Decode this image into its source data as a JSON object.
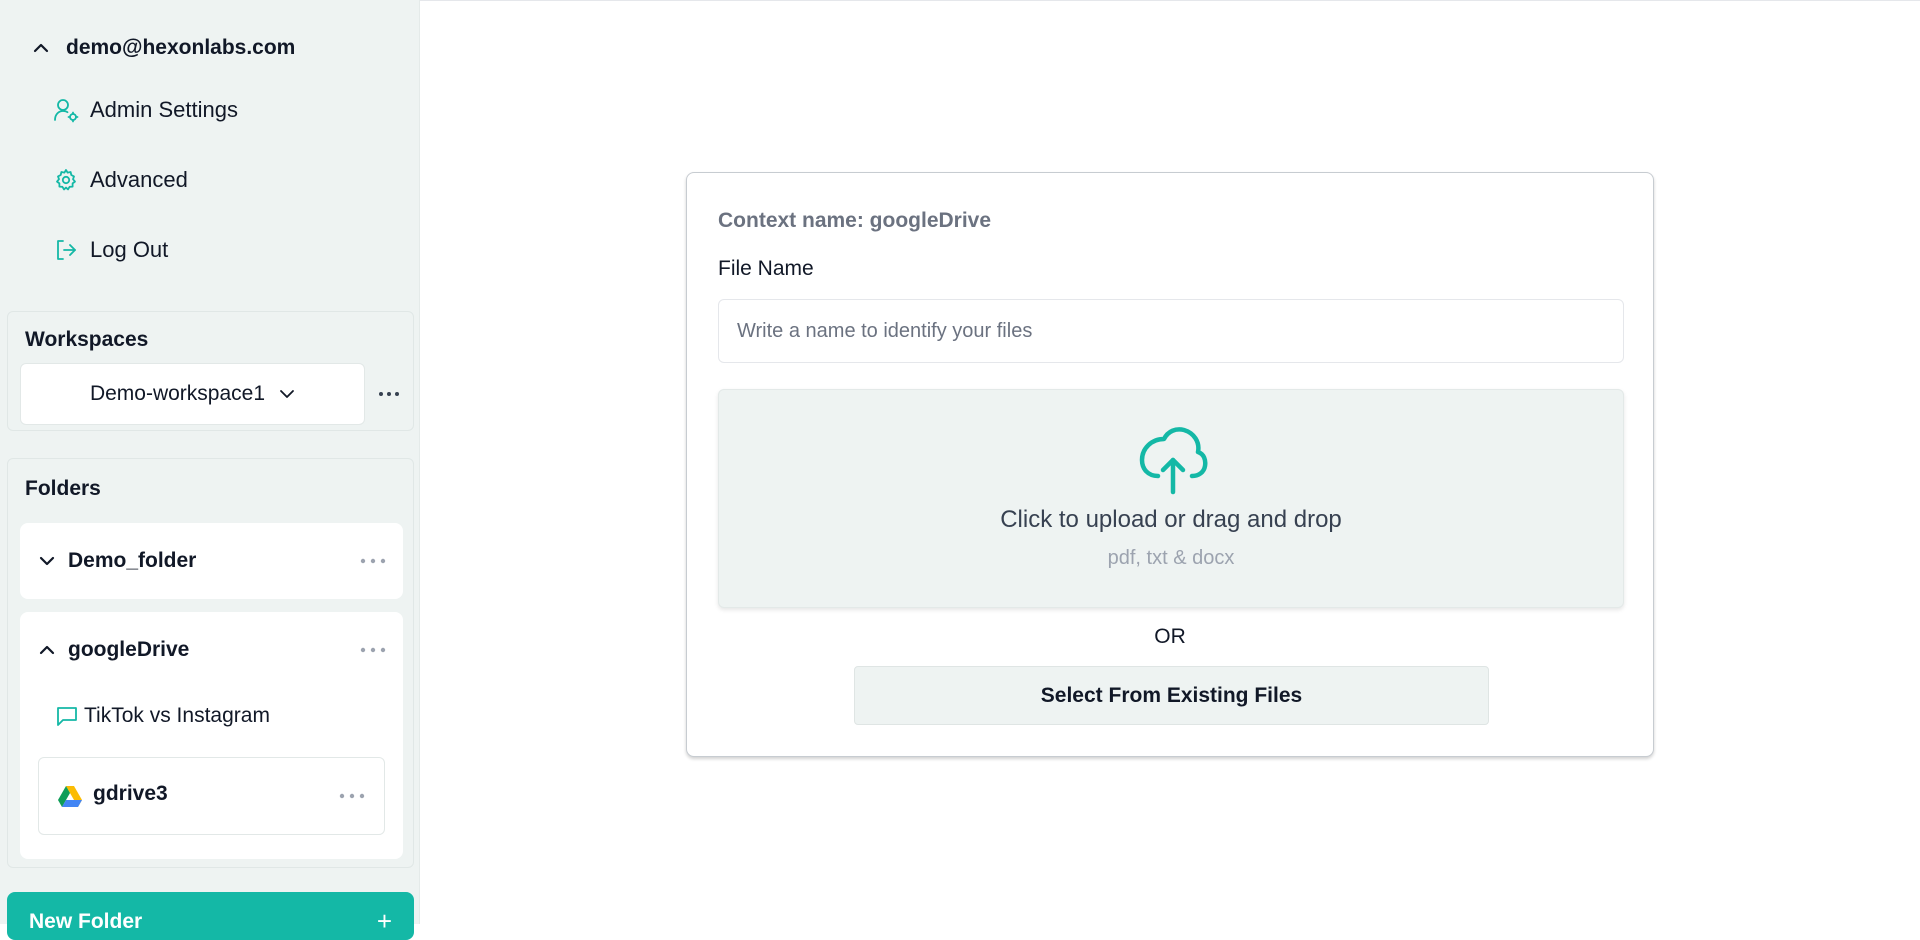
{
  "account": {
    "email": "demo@hexonlabs.com"
  },
  "menu": {
    "admin_settings": "Admin Settings",
    "advanced": "Advanced",
    "log_out": "Log Out"
  },
  "workspaces": {
    "title": "Workspaces",
    "selected": "Demo-workspace1"
  },
  "folders": {
    "title": "Folders",
    "items": [
      {
        "name": "Demo_folder",
        "expanded": false
      },
      {
        "name": "googleDrive",
        "expanded": true,
        "chats": [
          {
            "label": "TikTok vs Instagram"
          }
        ],
        "sources": [
          {
            "name": "gdrive3",
            "icon": "google-drive-icon"
          }
        ]
      }
    ],
    "new_folder_label": "New Folder",
    "new_folder_plus": "+"
  },
  "upload": {
    "context_name": "Context name: googleDrive",
    "file_name_label": "File Name",
    "file_name_placeholder": "Write a name to identify your files",
    "file_name_value": "",
    "dropzone_text": "Click to upload or drag and drop",
    "dropzone_types": "pdf, txt & docx",
    "or_text": "OR",
    "select_existing_label": "Select From Existing Files"
  },
  "colors": {
    "accent": "#14b8a6",
    "sidebar_bg": "#eef3f2"
  }
}
